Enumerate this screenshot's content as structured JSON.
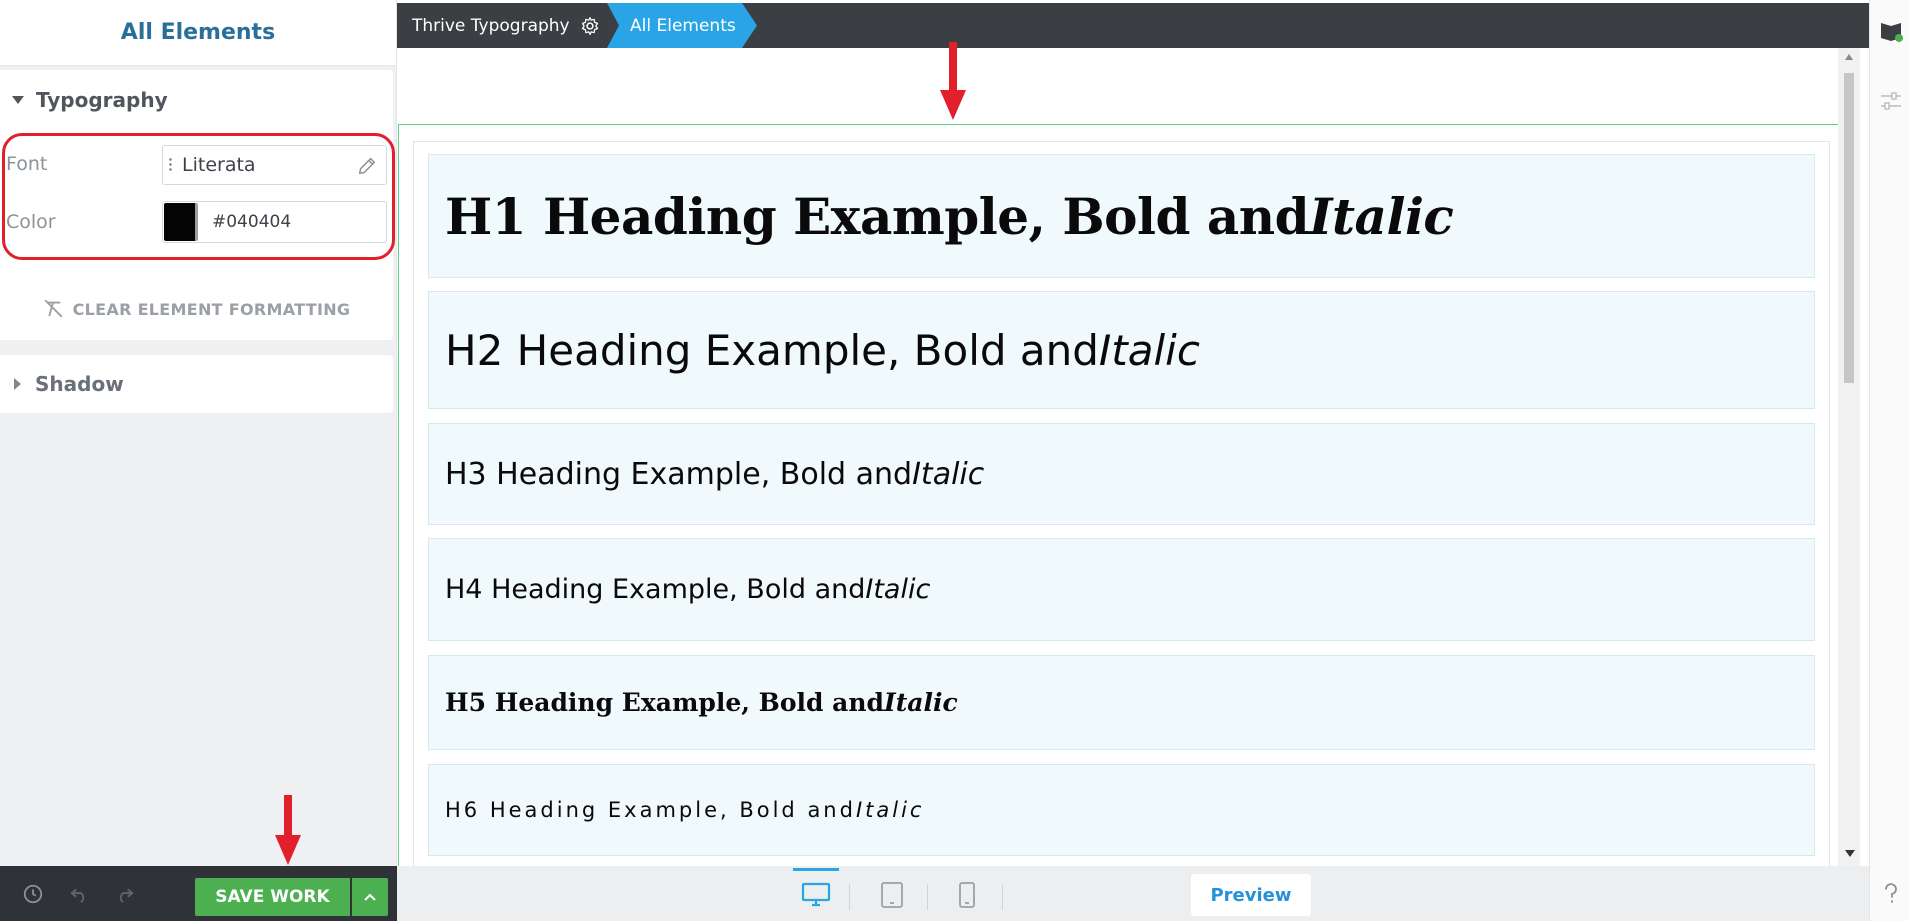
{
  "sidebar": {
    "title": "All Elements",
    "typography": {
      "title": "Typography",
      "font_label": "Font",
      "font_value": "Literata",
      "color_label": "Color",
      "color_value": "#040404",
      "clear_label": "CLEAR ELEMENT FORMATTING"
    },
    "shadow": {
      "title": "Shadow"
    }
  },
  "breadcrumb": {
    "item1": "Thrive Typography",
    "item2": "All Elements"
  },
  "canvas": {
    "headings": [
      {
        "text": "H1 Heading Example, Bold and ",
        "italic": "Italic"
      },
      {
        "text": "H2 Heading Example, Bold and ",
        "italic": "Italic"
      },
      {
        "text": "H3 Heading Example, Bold and ",
        "italic": "Italic"
      },
      {
        "text": "H4 Heading Example, Bold and ",
        "italic": "Italic"
      },
      {
        "text": "H5 Heading Example, Bold and ",
        "italic": "Italic"
      },
      {
        "text": "H6 Heading Example, Bold and ",
        "italic": "Italic"
      }
    ]
  },
  "bottom_bar": {
    "save_label": "SAVE WORK"
  },
  "device_bar": {
    "preview_label": "Preview",
    "devices": [
      "desktop-icon",
      "tablet-icon",
      "mobile-icon"
    ],
    "active": "desktop-icon"
  },
  "colors": {
    "accent_blue": "#29a4e6",
    "save_green": "#4caf50",
    "topbar_dark": "#3b3e42",
    "annotation_red": "#e2202b",
    "heading_color": "#040404"
  }
}
